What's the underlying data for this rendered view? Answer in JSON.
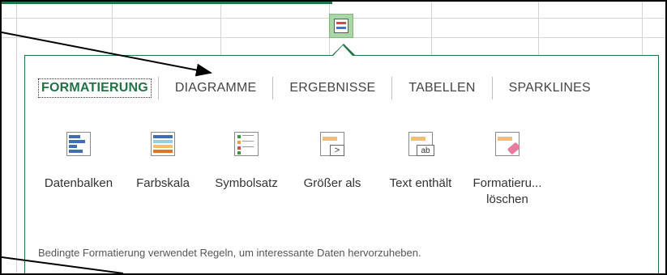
{
  "tabs": [
    {
      "label": "FORMATIERUNG",
      "active": true
    },
    {
      "label": "DIAGRAMME",
      "active": false
    },
    {
      "label": "ERGEBNISSE",
      "active": false
    },
    {
      "label": "TABELLEN",
      "active": false
    },
    {
      "label": "SPARKLINES",
      "active": false
    }
  ],
  "items": [
    {
      "label": "Datenbalken",
      "icon": "data-bars-icon"
    },
    {
      "label": "Farbskala",
      "icon": "color-scale-icon"
    },
    {
      "label": "Symbolsatz",
      "icon": "icon-set-icon"
    },
    {
      "label": "Größer als",
      "icon": "greater-than-icon"
    },
    {
      "label": "Text enthält",
      "icon": "text-contains-icon"
    },
    {
      "label_line1": "Formatieru...",
      "label_line2": "löschen",
      "icon": "clear-format-icon"
    }
  ],
  "icon_glyphs": {
    "greater": ">",
    "text": "ab"
  },
  "description": "Bedingte Formatierung verwendet Regeln, um interessante Daten hervorzuheben.",
  "colors": {
    "accent": "#217346",
    "bars_blue": "#3f6fb2",
    "warm": "#f2c06b",
    "eraser": "#e87aa0"
  }
}
